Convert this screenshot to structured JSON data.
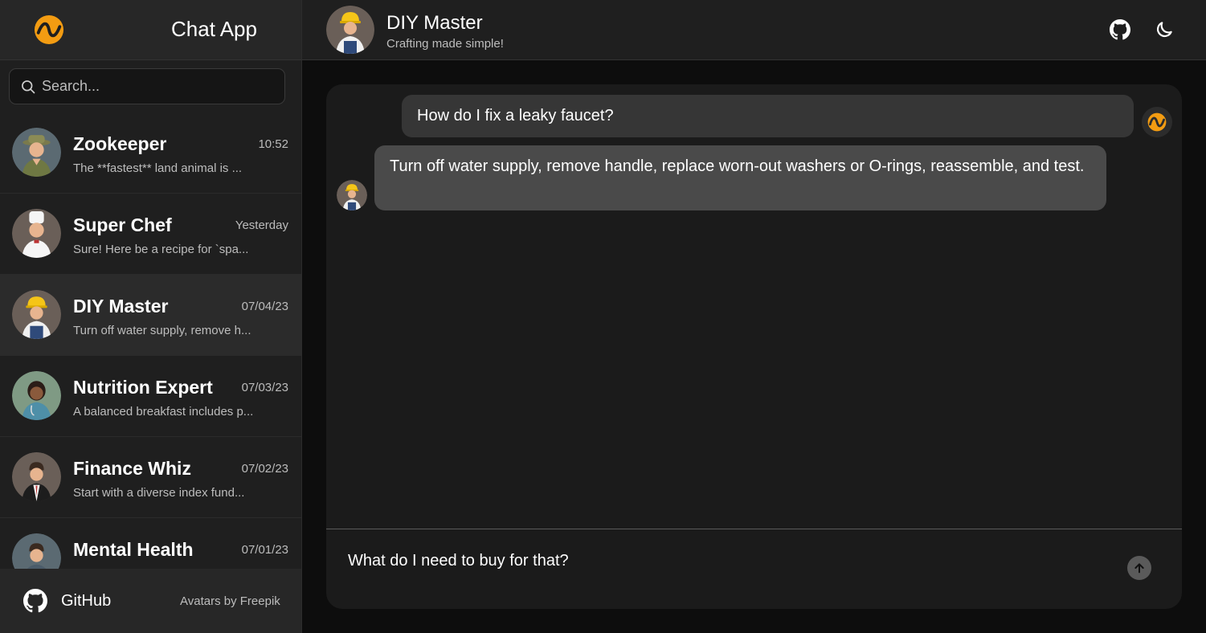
{
  "app": {
    "title": "Chat App"
  },
  "search": {
    "placeholder": "Search..."
  },
  "conversations": [
    {
      "name": "Zookeeper",
      "time": "10:52",
      "preview": "The **fastest** land animal is ...",
      "avatar": "zookeeper-avatar"
    },
    {
      "name": "Super Chef",
      "time": "Yesterday",
      "preview": "Sure! Here be a recipe for `spa...",
      "avatar": "chef-avatar"
    },
    {
      "name": "DIY Master",
      "time": "07/04/23",
      "preview": "Turn off water supply, remove h...",
      "avatar": "builder-avatar",
      "active": true
    },
    {
      "name": "Nutrition Expert",
      "time": "07/03/23",
      "preview": "A balanced breakfast includes p...",
      "avatar": "doctor-avatar"
    },
    {
      "name": "Finance Whiz",
      "time": "07/02/23",
      "preview": "Start with a diverse index fund...",
      "avatar": "businessman-avatar"
    },
    {
      "name": "Mental Health",
      "time": "07/01/23",
      "preview": "",
      "avatar": "therapist-avatar"
    }
  ],
  "footer": {
    "github_label": "GitHub",
    "credits": "Avatars by Freepik"
  },
  "header": {
    "title": "DIY Master",
    "subtitle": "Crafting made simple!"
  },
  "messages": [
    {
      "role": "user",
      "text": "How do I fix a leaky faucet?"
    },
    {
      "role": "assistant",
      "text": "Turn off water supply, remove handle, replace worn-out washers or O-rings, reassemble, and test."
    }
  ],
  "composer": {
    "value": "What do I need to buy for that?"
  },
  "colors": {
    "accent": "#f39c12",
    "background": "#0d0d0d",
    "panel": "#1b1b1b",
    "user_bubble": "#363636",
    "assistant_bubble": "#4a4a4a"
  }
}
